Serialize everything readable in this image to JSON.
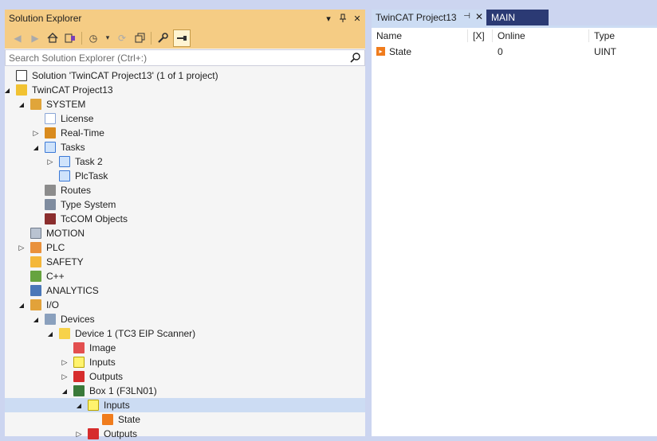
{
  "solution_explorer": {
    "title": "Solution Explorer",
    "search_placeholder": "Search Solution Explorer (Ctrl+:)",
    "tree": [
      {
        "label": "Solution 'TwinCAT Project13' (1 of 1 project)",
        "icon": "solution-icon",
        "level": 0,
        "expander": "none"
      },
      {
        "label": "TwinCAT Project13",
        "icon": "twincat-project-icon",
        "level": 0,
        "expander": "expanded"
      },
      {
        "label": "SYSTEM",
        "icon": "system-icon",
        "level": 1,
        "expander": "expanded"
      },
      {
        "label": "License",
        "icon": "license-icon",
        "level": 2,
        "expander": "none"
      },
      {
        "label": "Real-Time",
        "icon": "real-time-icon",
        "level": 2,
        "expander": "collapsed"
      },
      {
        "label": "Tasks",
        "icon": "tasks-icon",
        "level": 2,
        "expander": "expanded"
      },
      {
        "label": "Task 2",
        "icon": "task-icon",
        "level": 3,
        "expander": "collapsed"
      },
      {
        "label": "PlcTask",
        "icon": "task-icon",
        "level": 3,
        "expander": "none"
      },
      {
        "label": "Routes",
        "icon": "routes-icon",
        "level": 2,
        "expander": "none"
      },
      {
        "label": "Type System",
        "icon": "type-system-icon",
        "level": 2,
        "expander": "none"
      },
      {
        "label": "TcCOM Objects",
        "icon": "tccom-objects-icon",
        "level": 2,
        "expander": "none"
      },
      {
        "label": "MOTION",
        "icon": "motion-icon",
        "level": 1,
        "expander": "none"
      },
      {
        "label": "PLC",
        "icon": "plc-icon",
        "level": 1,
        "expander": "collapsed"
      },
      {
        "label": "SAFETY",
        "icon": "safety-icon",
        "level": 1,
        "expander": "none"
      },
      {
        "label": "C++",
        "icon": "cpp-icon",
        "level": 1,
        "expander": "none"
      },
      {
        "label": "ANALYTICS",
        "icon": "analytics-icon",
        "level": 1,
        "expander": "none"
      },
      {
        "label": "I/O",
        "icon": "io-icon",
        "level": 1,
        "expander": "expanded"
      },
      {
        "label": "Devices",
        "icon": "devices-icon",
        "level": 2,
        "expander": "expanded"
      },
      {
        "label": "Device 1 (TC3 EIP Scanner)",
        "icon": "device-icon",
        "level": 3,
        "expander": "expanded"
      },
      {
        "label": "Image",
        "icon": "image-icon",
        "level": 4,
        "expander": "none"
      },
      {
        "label": "Inputs",
        "icon": "inputs-icon",
        "level": 4,
        "expander": "collapsed"
      },
      {
        "label": "Outputs",
        "icon": "outputs-icon",
        "level": 4,
        "expander": "collapsed"
      },
      {
        "label": "Box 1 (F3LN01)",
        "icon": "box-icon",
        "level": 4,
        "expander": "expanded"
      },
      {
        "label": "Inputs",
        "icon": "inputs-icon",
        "level": 5,
        "expander": "expanded",
        "selected": true
      },
      {
        "label": "State",
        "icon": "state-variable-icon",
        "level": 6,
        "expander": "none"
      },
      {
        "label": "Outputs",
        "icon": "outputs-icon",
        "level": 5,
        "expander": "collapsed"
      }
    ]
  },
  "document": {
    "tabs": [
      {
        "label": "TwinCAT Project13",
        "active": true
      },
      {
        "label": "MAIN",
        "active": false
      }
    ],
    "columns": [
      "Name",
      "[X]",
      "Online",
      "Type"
    ],
    "rows": [
      {
        "name": "State",
        "x": "",
        "online": "0",
        "type": "UINT"
      }
    ]
  }
}
